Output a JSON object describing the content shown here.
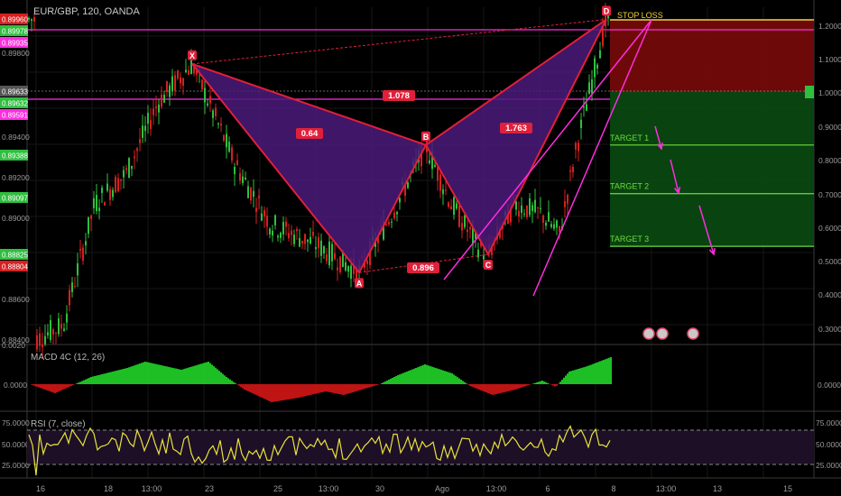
{
  "title": "EUR/GBP, 120, OANDA",
  "colors": {
    "background": "#000000",
    "bull": "#2fbf3f",
    "bear": "#d62020",
    "pattern_line": "#e0203a",
    "pattern_fill": "#4b1a7a",
    "trend_line": "#ff2de0",
    "stop_zone": "#7a0a0a",
    "target_zone": "#0a4a12",
    "target_line": "#6ddc3a",
    "stop_line": "#f2d23a",
    "rsi_line": "#e8e23a",
    "macd_up": "#22e02a",
    "macd_down": "#e01818"
  },
  "left_axis": {
    "ticks": [
      "0.89800",
      "0.89400",
      "0.89200",
      "0.89000",
      "0.88600",
      "0.88400"
    ],
    "badges": [
      {
        "text": "0.89960",
        "color": "#d62020"
      },
      {
        "text": "0.89978",
        "color": "#2fbf3f"
      },
      {
        "text": "0.89935",
        "color": "#ff2de0"
      },
      {
        "text": "0.89633",
        "color": "#555555"
      },
      {
        "text": "0.89632",
        "color": "#2fbf3f"
      },
      {
        "text": "0.89591",
        "color": "#ff2de0"
      },
      {
        "text": "0.89388",
        "color": "#2fbf3f"
      },
      {
        "text": "0.89097",
        "color": "#2fbf3f"
      },
      {
        "text": "0.88825",
        "color": "#2fbf3f"
      },
      {
        "text": "0.88804",
        "color": "#d62020"
      }
    ],
    "macd_tick": "0.0000",
    "macd_top_tick": "0.0020",
    "rsi_ticks": [
      "75.0000",
      "50.0000",
      "25.0000"
    ]
  },
  "right_axis": {
    "ticks": [
      "1.2000",
      "1.1000",
      "1.0000",
      "0.9000",
      "0.8000",
      "0.7000",
      "0.6000",
      "0.5000",
      "0.4000",
      "0.3000"
    ],
    "macd_tick": "0.0000",
    "rsi_ticks": [
      "75.0000",
      "50.0000",
      "25.0000"
    ]
  },
  "x_axis": {
    "labels": [
      "16",
      "18",
      "13:00",
      "23",
      "25",
      "13:00",
      "30",
      "Ago",
      "13:00",
      "6",
      "8",
      "13:00",
      "13",
      "15"
    ]
  },
  "pattern": {
    "points": {
      "X": "X",
      "A": "A",
      "B": "B",
      "C": "C",
      "D": "D"
    },
    "ratios": {
      "XB": "0.64",
      "AC": "0.896",
      "BD": "1.763",
      "XD": "1.078"
    }
  },
  "targets": {
    "stop_loss": "STOP LOSS",
    "target1": "TARGET 1",
    "target2": "TARGET 2",
    "target3": "TARGET 3"
  },
  "macd": {
    "label": "MACD 4C (12, 26)"
  },
  "rsi": {
    "label": "RSI (7, close)"
  },
  "chart_data": {
    "type": "candlestick",
    "symbol": "EUR/GBP",
    "interval": "120",
    "source": "OANDA",
    "ylim": [
      0.8836,
      0.9002
    ],
    "pattern_points": [
      {
        "label": "X",
        "price": 0.8974
      },
      {
        "label": "A",
        "price": 0.8871
      },
      {
        "label": "B",
        "price": 0.8934
      },
      {
        "label": "C",
        "price": 0.888
      },
      {
        "label": "D",
        "price": 0.8996
      }
    ],
    "ratios": [
      {
        "leg": "XB",
        "value": 0.64
      },
      {
        "leg": "AC",
        "value": 0.896
      },
      {
        "leg": "BD",
        "value": 1.763
      },
      {
        "leg": "XD",
        "value": 1.078
      }
    ],
    "levels": [
      {
        "name": "STOP LOSS",
        "price": 0.8998
      },
      {
        "name": "TARGET 1",
        "price": 0.8934
      },
      {
        "name": "TARGET 2",
        "price": 0.891
      },
      {
        "name": "TARGET 3",
        "price": 0.8884
      }
    ],
    "rsi_levels": [
      70,
      30
    ]
  }
}
